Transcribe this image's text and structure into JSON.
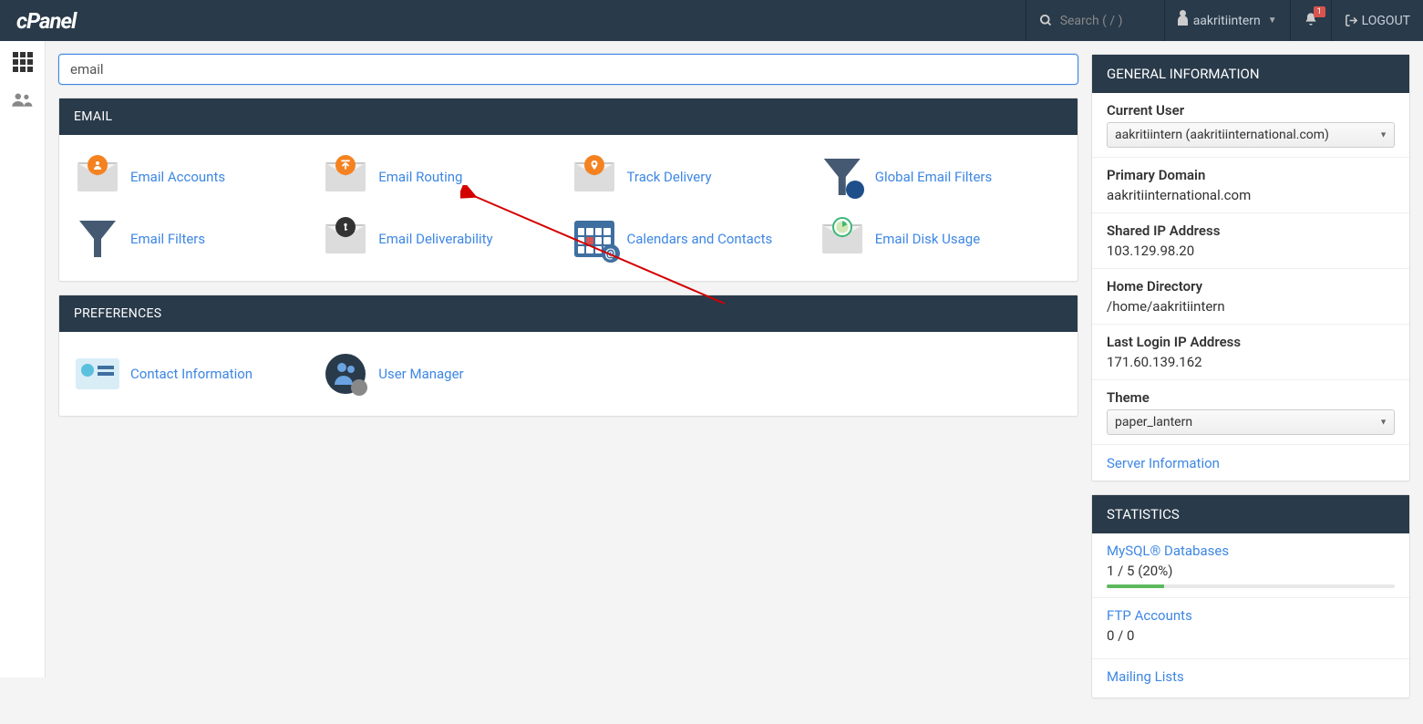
{
  "header": {
    "logo": "cPanel",
    "search_placeholder": "Search ( / )",
    "username": "aakritiintern",
    "notification_count": "1",
    "logout_label": "LOGOUT"
  },
  "main_search": {
    "value": "email"
  },
  "sections": {
    "email": {
      "title": "EMAIL",
      "items": [
        {
          "label": "Email Accounts"
        },
        {
          "label": "Email Routing"
        },
        {
          "label": "Track Delivery"
        },
        {
          "label": "Global Email Filters"
        },
        {
          "label": "Email Filters"
        },
        {
          "label": "Email Deliverability"
        },
        {
          "label": "Calendars and Contacts"
        },
        {
          "label": "Email Disk Usage"
        }
      ]
    },
    "preferences": {
      "title": "PREFERENCES",
      "items": [
        {
          "label": "Contact Information"
        },
        {
          "label": "User Manager"
        }
      ]
    }
  },
  "sidebar": {
    "general_title": "GENERAL INFORMATION",
    "current_user_label": "Current User",
    "current_user_value": "aakritiintern (aakritiinternational.com)",
    "primary_domain_label": "Primary Domain",
    "primary_domain_value": "aakritiinternational.com",
    "shared_ip_label": "Shared IP Address",
    "shared_ip_value": "103.129.98.20",
    "home_dir_label": "Home Directory",
    "home_dir_value": "/home/aakritiintern",
    "last_login_label": "Last Login IP Address",
    "last_login_value": "171.60.139.162",
    "theme_label": "Theme",
    "theme_value": "paper_lantern",
    "server_info_link": "Server Information",
    "stats_title": "STATISTICS",
    "stats": {
      "mysql_label": "MySQL® Databases",
      "mysql_value": "1 / 5   (20%)",
      "mysql_pct": 20,
      "ftp_label": "FTP Accounts",
      "ftp_value": "0 / 0",
      "mailing_label": "Mailing Lists"
    }
  }
}
